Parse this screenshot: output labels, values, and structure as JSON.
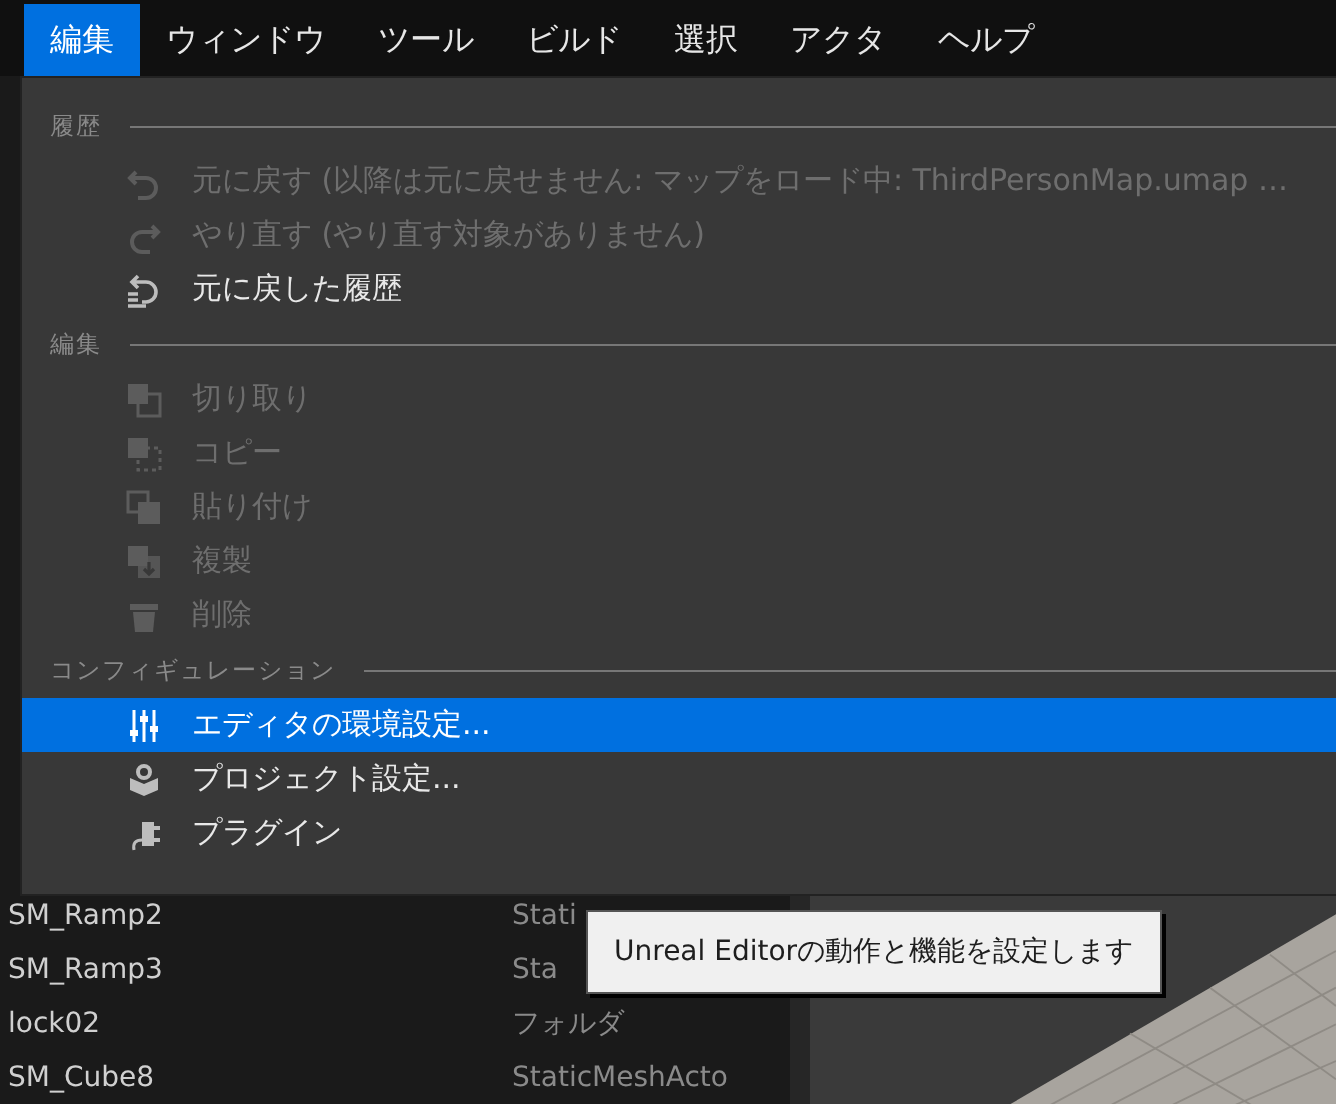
{
  "menubar": [
    {
      "label": "編集",
      "selected": true
    },
    {
      "label": "ウィンドウ",
      "selected": false
    },
    {
      "label": "ツール",
      "selected": false
    },
    {
      "label": "ビルド",
      "selected": false
    },
    {
      "label": "選択",
      "selected": false
    },
    {
      "label": "アクタ",
      "selected": false
    },
    {
      "label": "ヘルプ",
      "selected": false
    }
  ],
  "outliner": {
    "rows": [
      {
        "name": "SM_Ramp2",
        "type": "Stati"
      },
      {
        "name": "SM_Ramp3",
        "type": "Sta"
      },
      {
        "name": "lock02",
        "type": "フォルダ"
      },
      {
        "name": "SM_Cube8",
        "type": "StaticMeshActo"
      }
    ]
  },
  "menu": {
    "sections": [
      {
        "heading": "履歴",
        "items": [
          {
            "kind": "undo",
            "label": "元に戻す (以降は元に戻せません: マップをロード中: ThirdPersonMap.umap …",
            "disabled": true,
            "selected": false
          },
          {
            "kind": "redo",
            "label": "やり直す (やり直す対象がありません)",
            "disabled": true,
            "selected": false
          },
          {
            "kind": "history",
            "label": "元に戻した履歴",
            "disabled": false,
            "selected": false
          }
        ]
      },
      {
        "heading": "編集",
        "items": [
          {
            "kind": "cut",
            "label": "切り取り",
            "disabled": true,
            "selected": false
          },
          {
            "kind": "copy",
            "label": "コピー",
            "disabled": true,
            "selected": false
          },
          {
            "kind": "paste",
            "label": "貼り付け",
            "disabled": true,
            "selected": false
          },
          {
            "kind": "duplicate",
            "label": "複製",
            "disabled": true,
            "selected": false
          },
          {
            "kind": "delete",
            "label": "削除",
            "disabled": true,
            "selected": false
          }
        ]
      },
      {
        "heading": "コンフィギュレーション",
        "items": [
          {
            "kind": "settings",
            "label": "エディタの環境設定...",
            "disabled": false,
            "selected": true
          },
          {
            "kind": "project",
            "label": "プロジェクト設定...",
            "disabled": false,
            "selected": false
          },
          {
            "kind": "plugin",
            "label": "プラグイン",
            "disabled": false,
            "selected": false
          }
        ]
      }
    ]
  },
  "tooltip": {
    "text": "Unreal Editorの動作と機能を設定します"
  }
}
